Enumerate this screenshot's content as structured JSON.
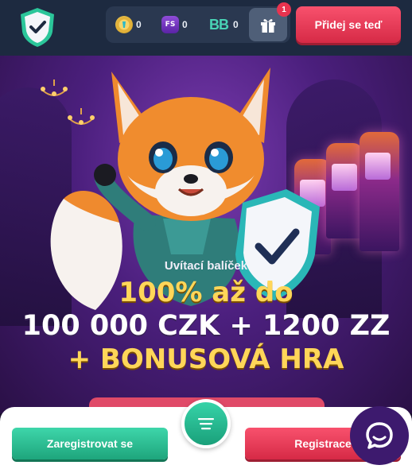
{
  "header": {
    "wallet": {
      "coins": {
        "icon": "coin-icon",
        "value": "0"
      },
      "free_spins": {
        "icon": "free-spins-icon",
        "icon_text": "FS",
        "value": "0"
      },
      "bonus_balance": {
        "icon": "bonus-balance-icon",
        "icon_text": "BB",
        "value": "0"
      }
    },
    "gift": {
      "icon": "gift-icon",
      "badge": "1"
    },
    "join_button": "Přidej se teď"
  },
  "banner": {
    "welcome": "Uvítací balíček",
    "line1": "100% až do",
    "line2": "100 000 CZK + 1200 ZZ",
    "line3": "+ BONUSOVÁ HRA"
  },
  "bottom": {
    "register_green": "Zaregistrovat se",
    "register_red": "Registrace",
    "menu_icon": "menu-icon",
    "chat_icon": "chat-icon"
  },
  "colors": {
    "header_bg": "#1d2a40",
    "accent_green": "#2cc494",
    "accent_red": "#e8334f",
    "gold_text": "#ffd659",
    "chat_bg": "#3d1a6e"
  }
}
